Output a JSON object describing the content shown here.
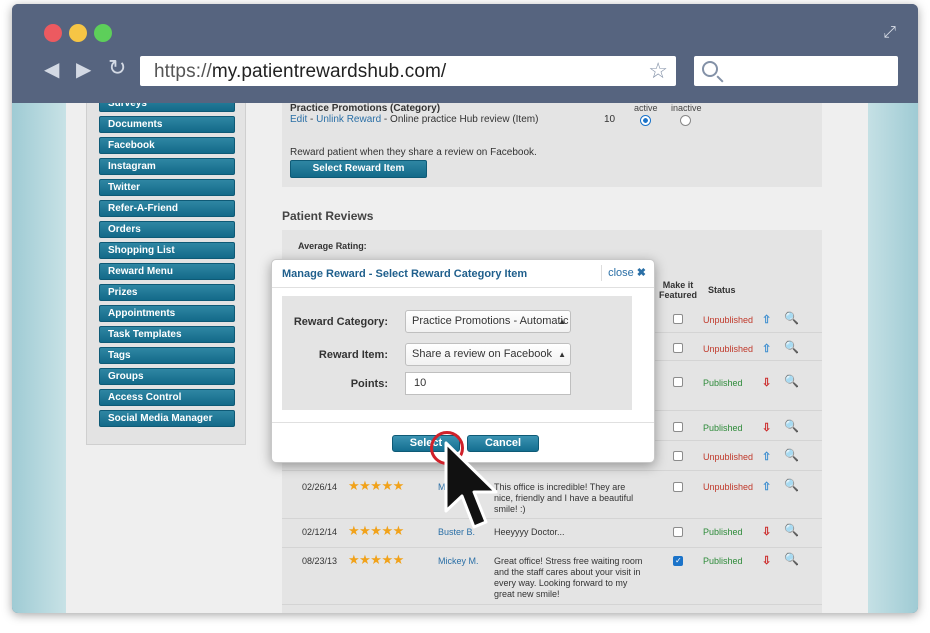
{
  "browser": {
    "url_scheme": "https://",
    "url_host": "my.patientrewardshub.com/"
  },
  "sidebar": {
    "items": [
      {
        "label": "Surveys"
      },
      {
        "label": "Documents"
      },
      {
        "label": "Facebook"
      },
      {
        "label": "Instagram"
      },
      {
        "label": "Twitter"
      },
      {
        "label": "Refer-A-Friend"
      },
      {
        "label": "Orders"
      },
      {
        "label": "Shopping List"
      },
      {
        "label": "Reward Menu"
      },
      {
        "label": "Prizes"
      },
      {
        "label": "Appointments"
      },
      {
        "label": "Task Templates"
      },
      {
        "label": "Tags"
      },
      {
        "label": "Groups"
      },
      {
        "label": "Access Control"
      },
      {
        "label": "Social Media Manager"
      }
    ]
  },
  "promo": {
    "category_heading": "Practice Promotions (Category)",
    "edit_link": "Edit",
    "separator": " - ",
    "unlink_link": "Unlink Reward",
    "item_text": " - Online practice Hub review (Item)",
    "qty": "10",
    "active_label": "active",
    "inactive_label": "inactive",
    "description": "Reward patient when they share a review on Facebook.",
    "select_button": "Select Reward Item"
  },
  "reviews": {
    "title": "Patient Reviews",
    "avg_label": "Average Rating:",
    "col_featured": "Make it Featured",
    "col_status": "Status",
    "rows": [
      {
        "date": "",
        "stars": "",
        "reviewer": "",
        "text": "",
        "featured": false,
        "status": "Unpublished"
      },
      {
        "date": "",
        "stars": "",
        "reviewer": "",
        "text": "",
        "featured": false,
        "status": "Unpublished"
      },
      {
        "date": "",
        "stars": "",
        "reviewer": "",
        "text": "",
        "featured": false,
        "status": "Published"
      },
      {
        "date": "",
        "stars": "",
        "reviewer": "",
        "text": "",
        "featured": false,
        "status": "Published"
      },
      {
        "date": "",
        "stars": "",
        "reviewer": "",
        "text": "",
        "featured": false,
        "status": "Unpublished"
      },
      {
        "date": "02/26/14",
        "stars": "★★★★★",
        "reviewer": "M",
        "text": "This office is incredible! They are nice, friendly and I have a beautiful smile! :)",
        "featured": false,
        "status": "Unpublished"
      },
      {
        "date": "02/12/14",
        "stars": "★★★★★",
        "reviewer": "Buster B.",
        "text": "Heeyyyy Doctor...",
        "featured": false,
        "status": "Published"
      },
      {
        "date": "08/23/13",
        "stars": "★★★★★",
        "reviewer": "Mickey M.",
        "text": "Great office! Stress free waiting room and the staff cares about your visit in every way. Looking forward to my great new smile!",
        "featured": true,
        "status": "Published"
      }
    ]
  },
  "modal": {
    "title": "Manage Reward - Select Reward Category Item",
    "close_label": "close",
    "close_x": "✖",
    "category_label": "Reward Category:",
    "category_value": "Practice Promotions - Automatic",
    "item_label": "Reward Item:",
    "item_value": "Share a review on Facebook",
    "points_label": "Points:",
    "points_value": "10",
    "select_button": "Select",
    "cancel_button": "Cancel"
  },
  "colors": {
    "chrome": "#56647f",
    "sidebar_button": "#136a89",
    "published": "#2e8b3a",
    "unpublished": "#c0392b",
    "star": "#f1a21a"
  }
}
